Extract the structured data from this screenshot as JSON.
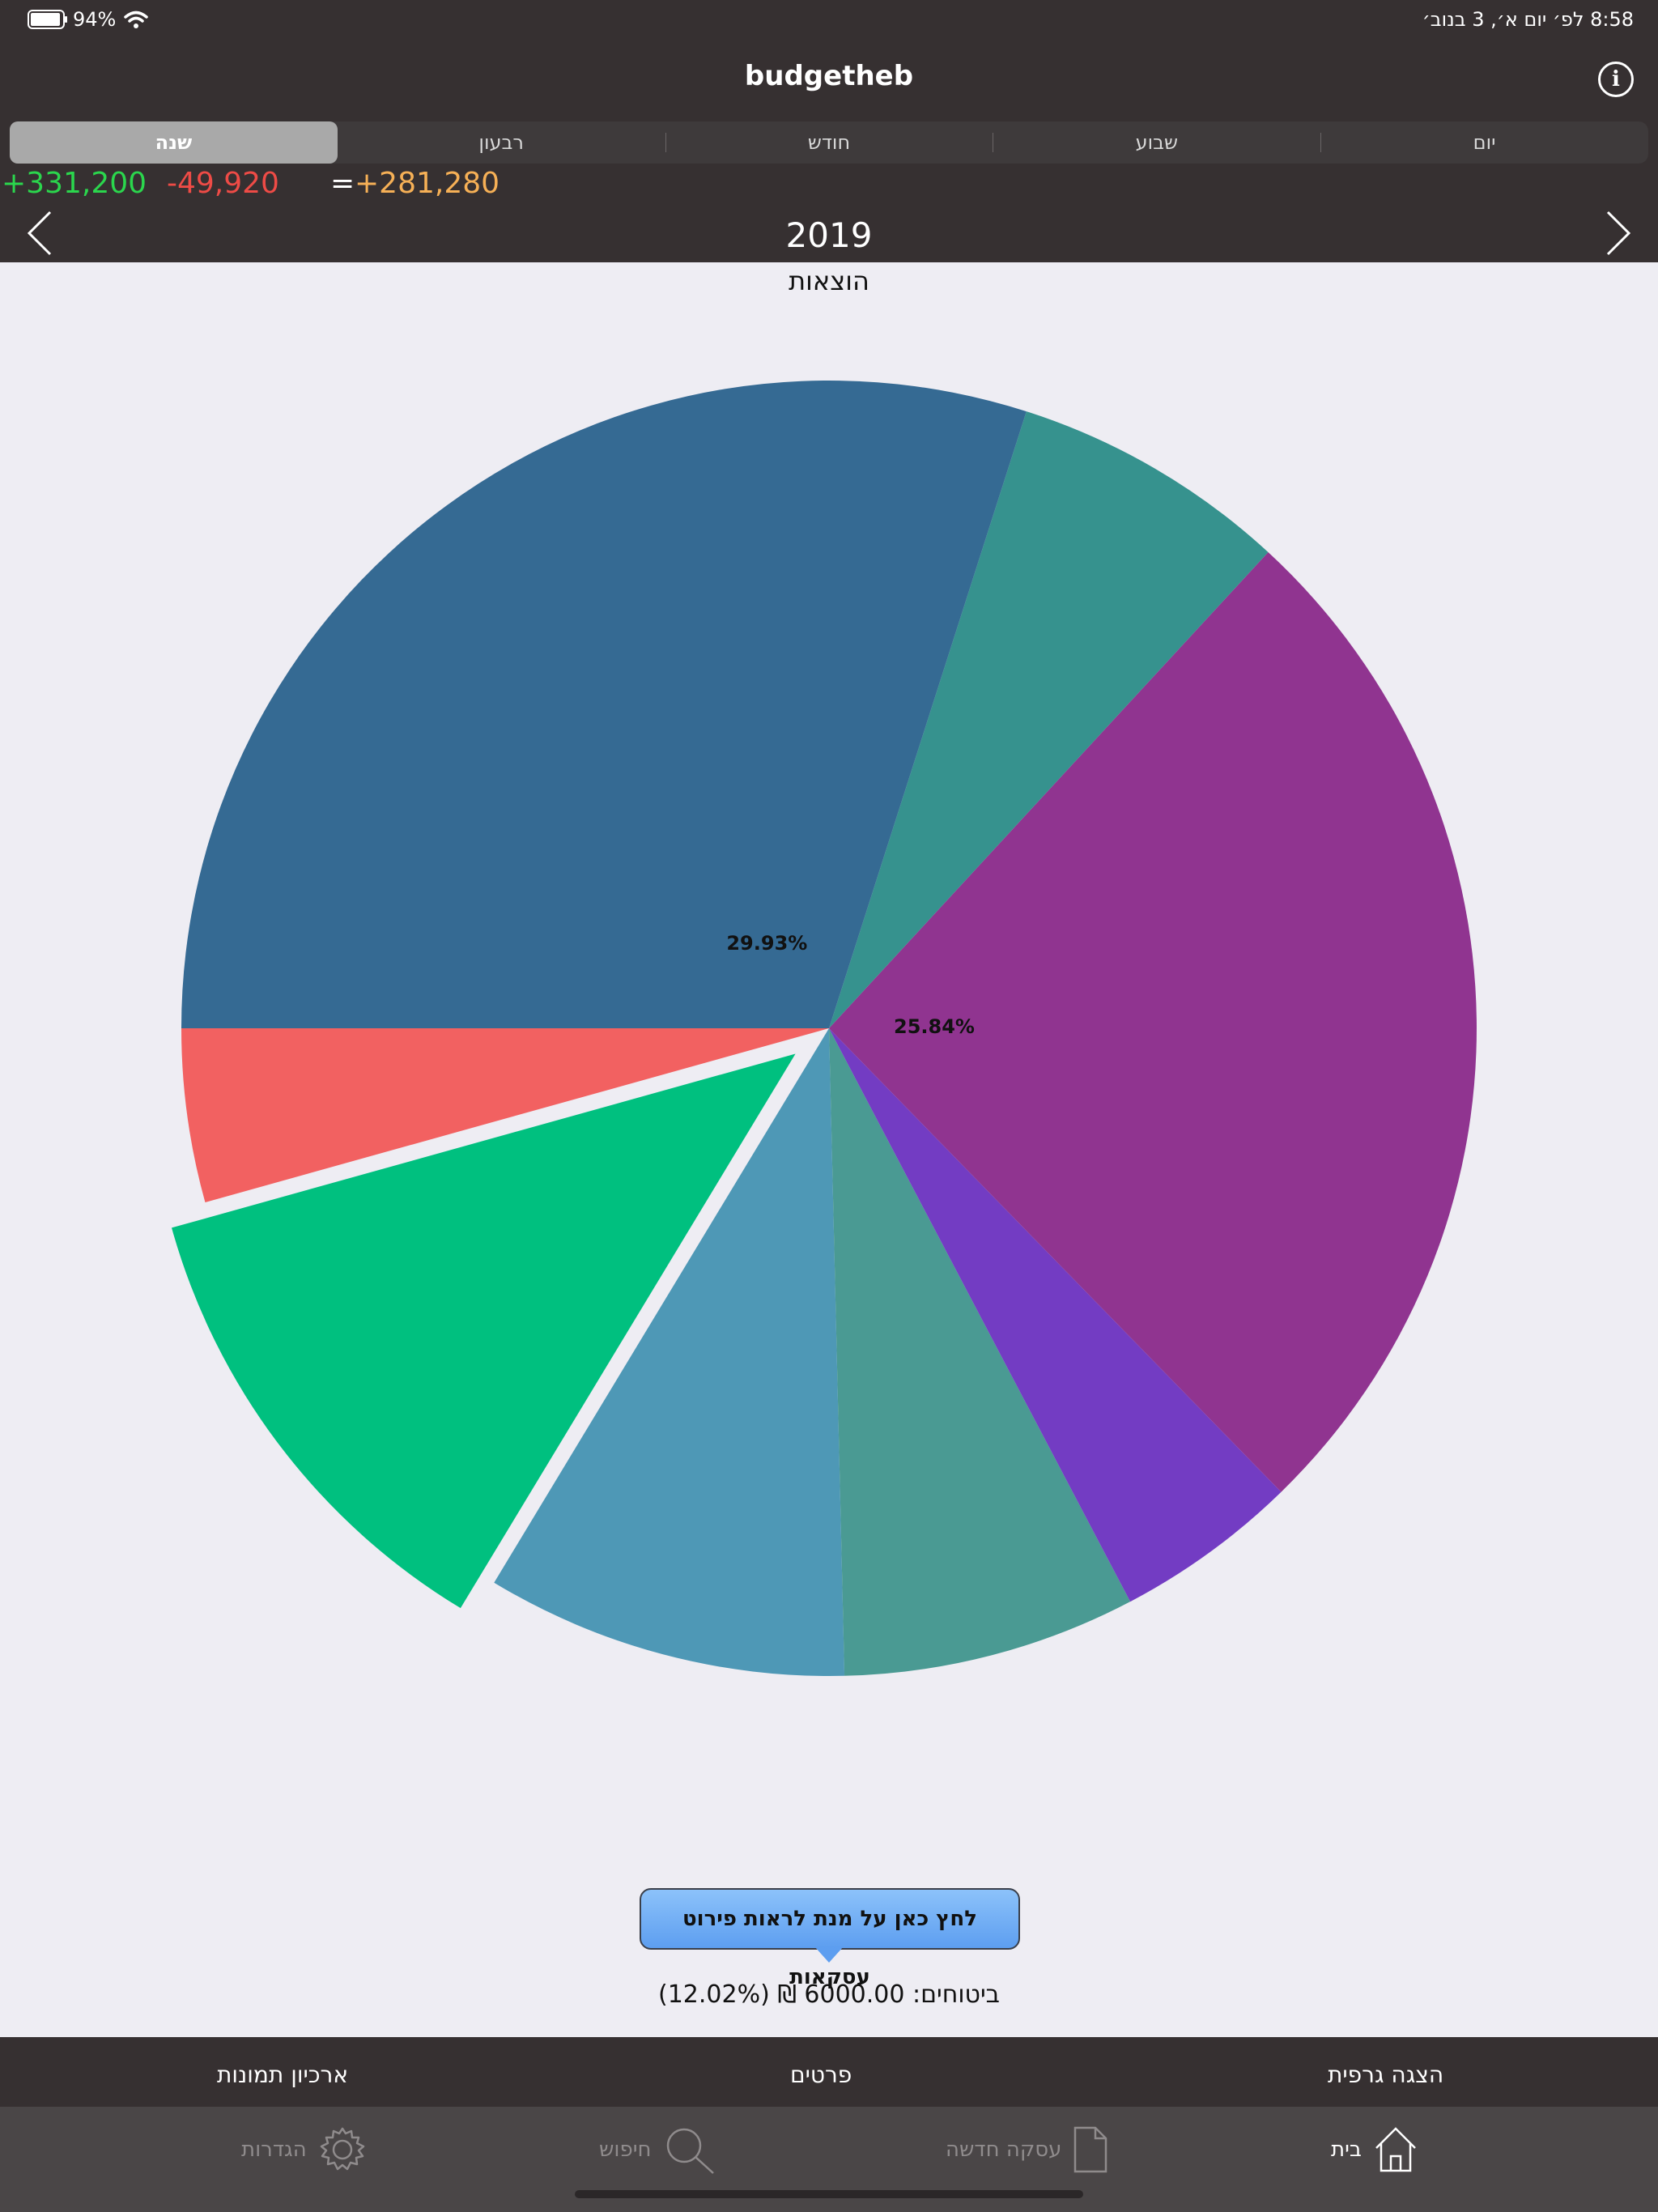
{
  "status": {
    "battery": "94%",
    "time_date": "8:58 לפ׳  יום א׳, 3 בנוב׳"
  },
  "header": {
    "title": "budgetheb"
  },
  "period_tabs": [
    {
      "label": "שנה",
      "active": true
    },
    {
      "label": "רבעון",
      "active": false
    },
    {
      "label": "חודש",
      "active": false
    },
    {
      "label": "שבוע",
      "active": false
    },
    {
      "label": "יום",
      "active": false
    }
  ],
  "summary": {
    "income": "+331,200",
    "expense": "-49,920",
    "equals": "=",
    "balance": "+281,280"
  },
  "year": "2019",
  "chart_data": {
    "type": "pie",
    "title": "הוצאות",
    "start_angle_deg": 180,
    "direction": "counterclockwise",
    "slices": [
      {
        "percent": 4.33,
        "color": "#f26161",
        "exploded": false
      },
      {
        "percent": 12.02,
        "color": "#00c07f",
        "exploded": true
      },
      {
        "percent": 9.03,
        "color": "#4e98b6",
        "exploded": false
      },
      {
        "percent": 7.32,
        "color": "#4a9a93",
        "exploded": false
      },
      {
        "percent": 4.6,
        "color": "#733cc3",
        "exploded": false
      },
      {
        "percent": 25.84,
        "color": "#903490",
        "exploded": false,
        "label": "25.84%"
      },
      {
        "percent": 6.93,
        "color": "#36928e",
        "exploded": false
      },
      {
        "percent": 29.93,
        "color": "#356a93",
        "exploded": false,
        "label": "29.93%"
      }
    ],
    "background": "#eeedf3"
  },
  "tooltip": {
    "text": "לחץ כאן על מנת לראות פירוט עסקאות"
  },
  "selected_info": "ביטוחים: 6000.00 ₪ (12.02%)",
  "bottom_menu": {
    "graph": "הצגה גרפית",
    "details": "פרטים",
    "photos": "ארכיון תמונות"
  },
  "tabs": [
    {
      "label": "בית",
      "icon": "home-icon",
      "active": true
    },
    {
      "label": "עסקה חדשה",
      "icon": "document-icon",
      "active": false
    },
    {
      "label": "חיפוש",
      "icon": "search-icon",
      "active": false
    },
    {
      "label": "הגדרות",
      "icon": "gear-icon",
      "active": false
    }
  ]
}
